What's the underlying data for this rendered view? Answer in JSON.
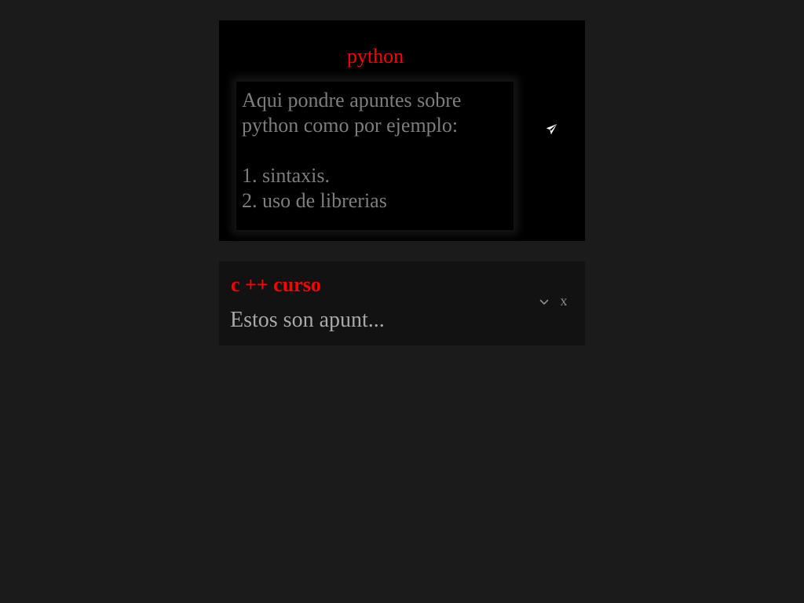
{
  "editor": {
    "title": "python",
    "content": "Aqui pondre apuntes sobre python como por ejemplo:\n\n1. sintaxis.\n2. uso de librerias",
    "send_icon": "paper-plane-icon"
  },
  "notes": [
    {
      "title": "c ++ curso",
      "preview": "Estos son apunt...",
      "expand_icon": "chevron-down-icon",
      "close_label": "x"
    }
  ],
  "colors": {
    "page_background": "#1b1b1b",
    "editor_background": "#000000",
    "note_background": "#121212",
    "accent_red": "#ff0000",
    "editor_text": "#7d7d7d",
    "note_preview_text": "#a8a8a8"
  }
}
